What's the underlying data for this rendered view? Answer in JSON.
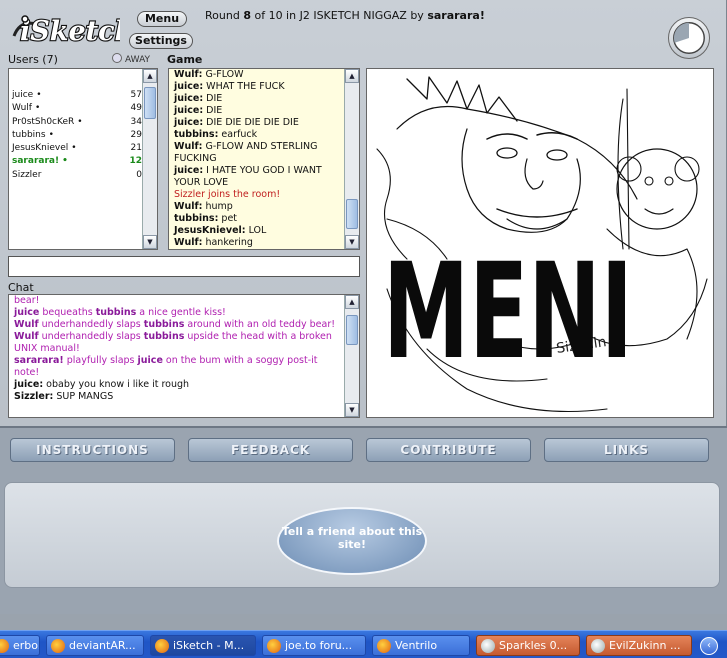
{
  "app": {
    "logo_text": "iSketch",
    "menu_label": "Menu",
    "settings_label": "Settings",
    "round_prefix": "Round",
    "round_number": "8",
    "round_of": "of 10 in J2 ISKETCH NIGGAZ by",
    "round_host": "sararara!"
  },
  "users": {
    "label": "Users (7)",
    "away_label": "AWAY",
    "list": [
      {
        "name": "juice",
        "marker": "•",
        "score": "57"
      },
      {
        "name": "Wulf",
        "marker": "•",
        "score": "49"
      },
      {
        "name": "Pr0stSh0cKeR",
        "marker": "•",
        "score": "34"
      },
      {
        "name": "tubbins",
        "marker": "•",
        "score": "29"
      },
      {
        "name": "JesusKnievel",
        "marker": "•",
        "score": "21"
      },
      {
        "name": "sararara!",
        "marker": "•",
        "score": "12"
      },
      {
        "name": "Sizzler",
        "marker": "",
        "score": "0"
      }
    ]
  },
  "game": {
    "label": "Game",
    "log": [
      {
        "who": "Wulf:",
        "text": " G-FLOW"
      },
      {
        "who": "juice:",
        "text": " WHAT THE FUCK"
      },
      {
        "who": "juice:",
        "text": " DIE"
      },
      {
        "who": "juice:",
        "text": " DIE"
      },
      {
        "who": "juice:",
        "text": " DIE DIE DIE DIE DIE"
      },
      {
        "who": "tubbins:",
        "text": " earfuck"
      },
      {
        "who": "Wulf:",
        "text": " G-FLOW AND STERLING FUCKING"
      },
      {
        "who": "juice:",
        "text": " I HATE YOU GOD I WANT YOUR LOVE"
      },
      {
        "who": "",
        "text": "Sizzler joins the room!",
        "system": true
      },
      {
        "who": "Wulf:",
        "text": " hump"
      },
      {
        "who": "tubbins:",
        "text": " pet"
      },
      {
        "who": "JesusKnievel:",
        "text": " LOL"
      },
      {
        "who": "Wulf:",
        "text": " hankering"
      }
    ]
  },
  "chat": {
    "label": "Chat",
    "input_value": "",
    "log": [
      {
        "type": "action",
        "parts": [
          {
            "t": "bear!"
          }
        ]
      },
      {
        "type": "action",
        "parts": [
          {
            "t": "juice",
            "b": true
          },
          {
            "t": " bequeaths "
          },
          {
            "t": "tubbins",
            "b": true
          },
          {
            "t": " a nice gentle kiss!"
          }
        ]
      },
      {
        "type": "action",
        "parts": [
          {
            "t": "Wulf",
            "b": true
          },
          {
            "t": " underhandedly slaps "
          },
          {
            "t": "tubbins",
            "b": true
          },
          {
            "t": " around with an old teddy bear!"
          }
        ]
      },
      {
        "type": "action",
        "parts": [
          {
            "t": "Wulf",
            "b": true
          },
          {
            "t": " underhandedly slaps "
          },
          {
            "t": "tubbins",
            "b": true
          },
          {
            "t": " upside the head with a broken UNIX manual!"
          }
        ]
      },
      {
        "type": "action",
        "parts": [
          {
            "t": "sararara!",
            "b": true
          },
          {
            "t": " playfully slaps "
          },
          {
            "t": "juice",
            "b": true
          },
          {
            "t": " on the bum with a soggy post-it note!"
          }
        ]
      },
      {
        "type": "say",
        "parts": [
          {
            "t": "juice:",
            "b": true
          },
          {
            "t": " obaby you know i like it rough"
          }
        ]
      },
      {
        "type": "say",
        "parts": [
          {
            "t": "Sizzler:",
            "b": true
          },
          {
            "t": " SUP MANGS"
          }
        ]
      }
    ]
  },
  "canvas": {
    "drawn_text": "MENI",
    "scribble_text": "Sizeuln"
  },
  "nav": [
    "INSTRUCTIONS",
    "FEEDBACK",
    "CONTRIBUTE",
    "LINKS"
  ],
  "footer": {
    "tell_friend": "Tell a friend about this site!"
  },
  "taskbar": [
    {
      "label": "erbo...",
      "style": "plain"
    },
    {
      "label": "deviantAR...",
      "style": "plain"
    },
    {
      "label": "iSketch - M...",
      "style": "active"
    },
    {
      "label": "joe.to foru...",
      "style": "plain"
    },
    {
      "label": "Ventrilo",
      "style": "plain"
    },
    {
      "label": "Sparkles 0...",
      "style": "orange"
    },
    {
      "label": "EvilZukinn ...",
      "style": "orange"
    }
  ]
}
